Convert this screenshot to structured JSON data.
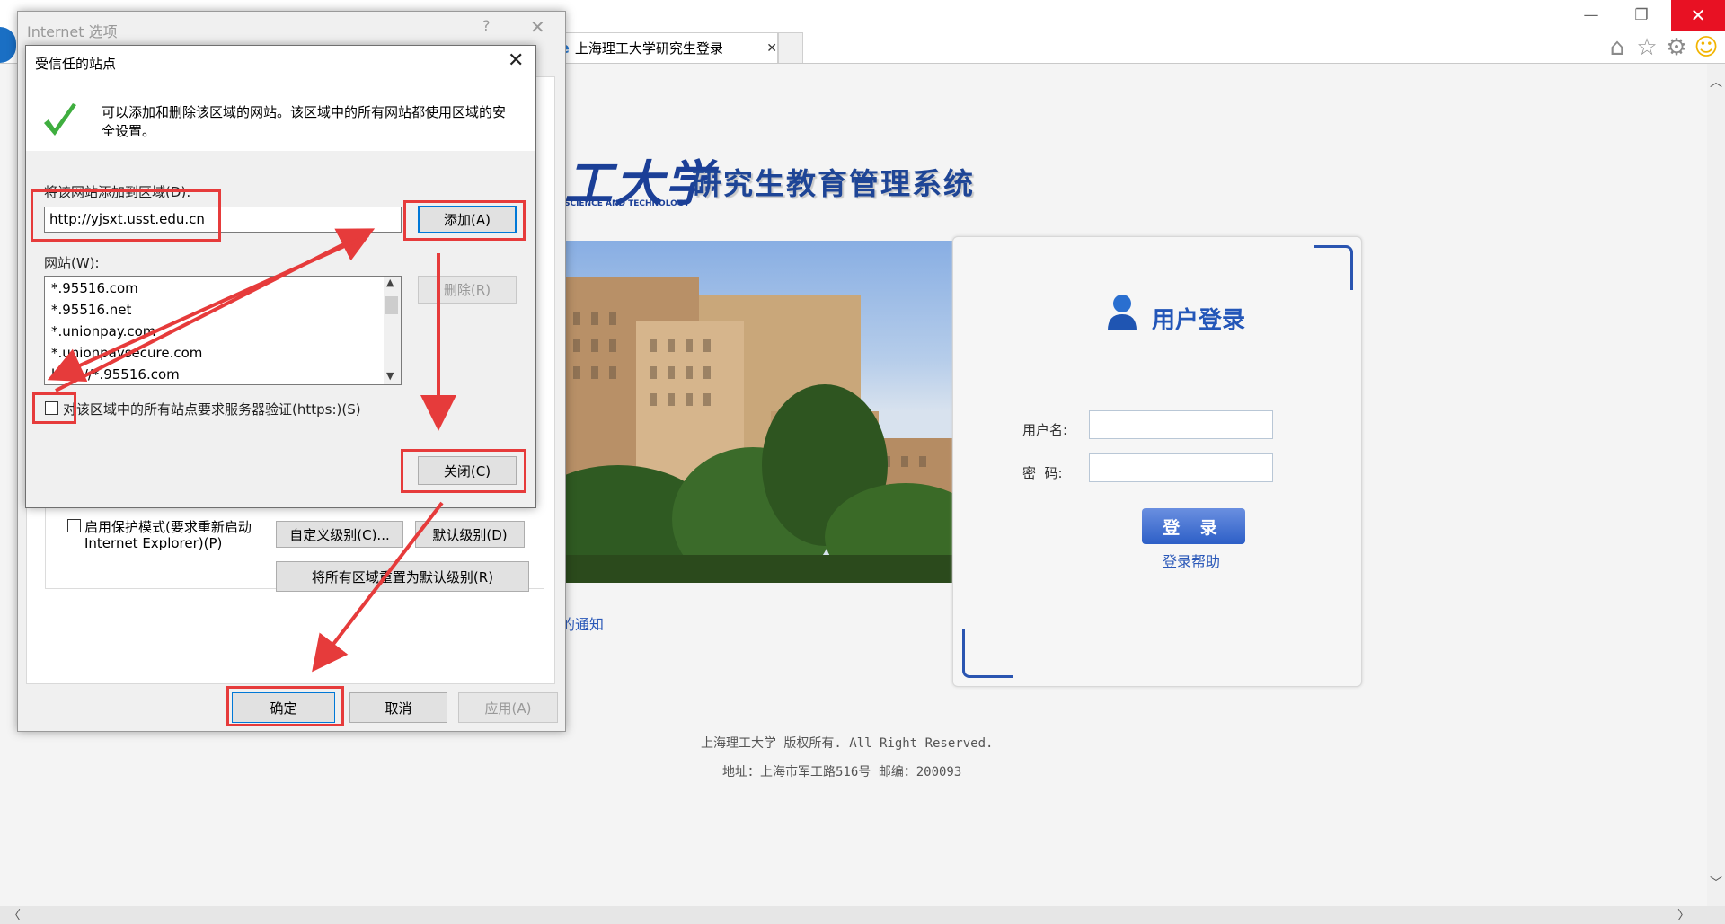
{
  "browser": {
    "tab_label": "上海理工大学研究生登录",
    "tab_close": "✕",
    "window_controls": [
      "—",
      "❐",
      "✕"
    ],
    "toolbar_icons": [
      "home-icon",
      "star-icon",
      "gear-icon",
      "smiley-icon"
    ]
  },
  "page": {
    "logo_text": "工大学",
    "logo_subtext": "SCIENCE AND TECHNOLOGY",
    "system_title": "研究生教育管理系统",
    "login_title": "用户登录",
    "username_label": "用户名:",
    "password_label": "密  码:",
    "login_button": "登 录",
    "help_link": "登录帮助",
    "notice_link": "的通知",
    "footer_line1": "上海理工大学 版权所有. All Right Reserved.",
    "footer_line2": "地址：上海市军工路516号 邮编：200093"
  },
  "internet_options": {
    "title": "Internet 选项",
    "help_glyph": "?",
    "close_glyph": "✕",
    "protected_mode_label_line1": "启用保护模式(要求重新启动",
    "protected_mode_label_line2": "Internet Explorer)(P)",
    "custom_level_button": "自定义级别(C)...",
    "default_level_button": "默认级别(D)",
    "reset_all_button": "将所有区域重置为默认级别(R)",
    "ok_button": "确定",
    "cancel_button": "取消",
    "apply_button": "应用(A)"
  },
  "trusted_sites": {
    "title": "受信任的站点",
    "close_glyph": "✕",
    "description": "可以添加和删除该区域的网站。该区域中的所有网站都使用区域的安全设置。",
    "add_label": "将该网站添加到区域(D):",
    "url_value": "http://yjsxt.usst.edu.cn",
    "add_button": "添加(A)",
    "websites_label": "网站(W):",
    "websites": [
      "*.95516.com",
      "*.95516.net",
      "*.unionpay.com",
      "*.unionpaysecure.com",
      "http://*.95516.com"
    ],
    "remove_button": "删除(R)",
    "https_checkbox_label": "对该区域中的所有站点要求服务器验证(https:)(S)",
    "https_checked": false,
    "close_button": "关闭(C)"
  },
  "annotation_color": "#e63b3b"
}
